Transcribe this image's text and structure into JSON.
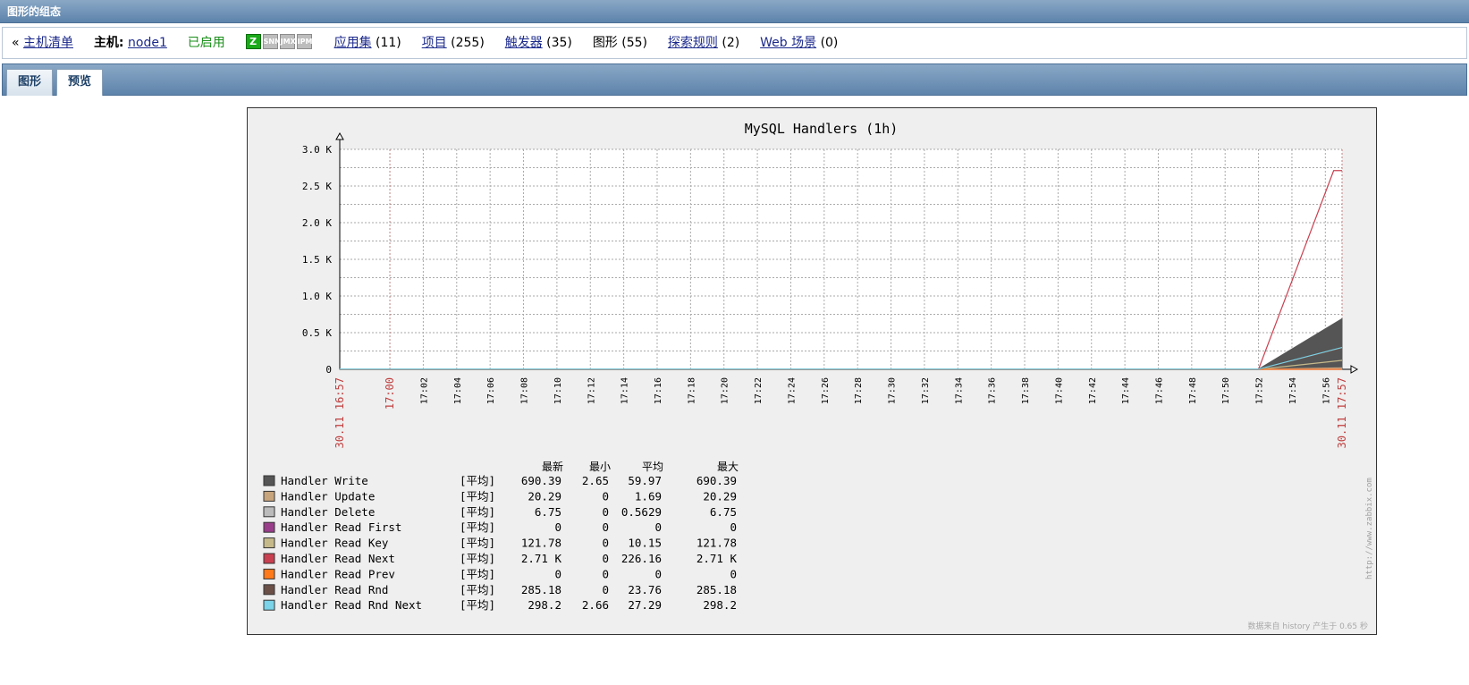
{
  "titlebar": {
    "text": "图形的组态"
  },
  "hostbar": {
    "back_arrow": "«",
    "host_list": "主机清单",
    "host_label": "主机:",
    "host_name": "node1",
    "status": "已启用",
    "availability": [
      {
        "label": "Z",
        "active": true
      },
      {
        "label": "SNMP",
        "active": false
      },
      {
        "label": "JMX",
        "active": false
      },
      {
        "label": "IPMI",
        "active": false
      }
    ],
    "links": [
      {
        "label": "应用集",
        "count": "(11)",
        "link": true
      },
      {
        "label": "项目",
        "count": "(255)",
        "link": true
      },
      {
        "label": "触发器",
        "count": "(35)",
        "link": true
      },
      {
        "label": "图形",
        "count": "(55)",
        "link": false
      },
      {
        "label": "探索规则",
        "count": "(2)",
        "link": true
      },
      {
        "label": "Web 场景",
        "count": "(0)",
        "link": true
      }
    ]
  },
  "tabs": [
    {
      "label": "图形",
      "active": false
    },
    {
      "label": "预览",
      "active": true
    }
  ],
  "colors": {
    "grid": "#aaaaaa",
    "axis": "#000000",
    "time_label_red": "#c04040",
    "chart_bg": "#efefef",
    "plot_bg": "#ffffff"
  },
  "chart_data": {
    "type": "area",
    "title": "MySQL Handlers (1h)",
    "ylim": [
      0,
      3000
    ],
    "y_ticks": [
      {
        "value": 0,
        "label": "0"
      },
      {
        "value": 500,
        "label": "0.5 K"
      },
      {
        "value": 1000,
        "label": "1.0 K"
      },
      {
        "value": 1500,
        "label": "1.5 K"
      },
      {
        "value": 2000,
        "label": "2.0 K"
      },
      {
        "value": 2500,
        "label": "2.5 K"
      },
      {
        "value": 3000,
        "label": "3.0 K"
      }
    ],
    "x_range": [
      "16:57",
      "17:57"
    ],
    "x_ticks": [
      "30.11 16:57",
      "17:00",
      "17:02",
      "17:04",
      "17:06",
      "17:08",
      "17:10",
      "17:12",
      "17:14",
      "17:16",
      "17:18",
      "17:20",
      "17:22",
      "17:24",
      "17:26",
      "17:28",
      "17:30",
      "17:32",
      "17:34",
      "17:36",
      "17:38",
      "17:40",
      "17:42",
      "17:44",
      "17:46",
      "17:48",
      "17:50",
      "17:52",
      "17:54",
      "17:56",
      "30.11 17:57"
    ],
    "x_ticks_red": [
      "30.11 16:57",
      "17:00",
      "30.11 17:57"
    ],
    "grid": true,
    "legend_columns": [
      "最新",
      "最小",
      "平均",
      "最大"
    ],
    "series": [
      {
        "name": "Handler Write",
        "func": "[平均]",
        "last": "690.39",
        "min": "2.65",
        "avg": "59.97",
        "max": "690.39",
        "color": "#555555",
        "style": "filled",
        "points": [
          [
            "16:57",
            2.65
          ],
          [
            "17:52",
            2.65
          ],
          [
            "17:57",
            690.39
          ]
        ]
      },
      {
        "name": "Handler Update",
        "func": "[平均]",
        "last": "20.29",
        "min": "0",
        "avg": "1.69",
        "max": "20.29",
        "color": "#c8a47c",
        "style": "line",
        "points": [
          [
            "16:57",
            0
          ],
          [
            "17:52",
            0
          ],
          [
            "17:57",
            20.29
          ]
        ]
      },
      {
        "name": "Handler Delete",
        "func": "[平均]",
        "last": "6.75",
        "min": "0",
        "avg": "0.5629",
        "max": "6.75",
        "color": "#bbbbbb",
        "style": "line",
        "points": [
          [
            "16:57",
            0
          ],
          [
            "17:52",
            0
          ],
          [
            "17:57",
            6.75
          ]
        ]
      },
      {
        "name": "Handler Read First",
        "func": "[平均]",
        "last": "0",
        "min": "0",
        "avg": "0",
        "max": "0",
        "color": "#993d8a",
        "style": "line",
        "points": [
          [
            "16:57",
            0
          ],
          [
            "17:57",
            0
          ]
        ]
      },
      {
        "name": "Handler Read Key",
        "func": "[平均]",
        "last": "121.78",
        "min": "0",
        "avg": "10.15",
        "max": "121.78",
        "color": "#c5b98a",
        "style": "line",
        "points": [
          [
            "16:57",
            0
          ],
          [
            "17:52",
            0
          ],
          [
            "17:57",
            121.78
          ]
        ]
      },
      {
        "name": "Handler Read Next",
        "func": "[平均]",
        "last": "2.71 K",
        "min": "0",
        "avg": "226.16",
        "max": "2.71 K",
        "color": "#c94050",
        "style": "line",
        "points": [
          [
            "16:57",
            0
          ],
          [
            "17:52",
            0
          ],
          [
            "17:56.5",
            2710
          ],
          [
            "17:57",
            2710
          ]
        ]
      },
      {
        "name": "Handler Read Prev",
        "func": "[平均]",
        "last": "0",
        "min": "0",
        "avg": "0",
        "max": "0",
        "color": "#ff7a1a",
        "style": "line",
        "points": [
          [
            "16:57",
            0
          ],
          [
            "17:57",
            0
          ]
        ]
      },
      {
        "name": "Handler Read Rnd",
        "func": "[平均]",
        "last": "285.18",
        "min": "0",
        "avg": "23.76",
        "max": "285.18",
        "color": "#6b5048",
        "style": "line",
        "points": [
          [
            "16:57",
            0
          ],
          [
            "17:52",
            0
          ],
          [
            "17:57",
            285.18
          ]
        ]
      },
      {
        "name": "Handler Read Rnd Next",
        "func": "[平均]",
        "last": "298.2",
        "min": "2.66",
        "avg": "27.29",
        "max": "298.2",
        "color": "#7ad3e8",
        "style": "line",
        "points": [
          [
            "16:57",
            2.66
          ],
          [
            "17:52",
            2.66
          ],
          [
            "17:57",
            298.2
          ]
        ]
      }
    ],
    "watermark": "http://www.zabbix.com",
    "footer": "数据来自 history  产生于 0.65 秒"
  }
}
